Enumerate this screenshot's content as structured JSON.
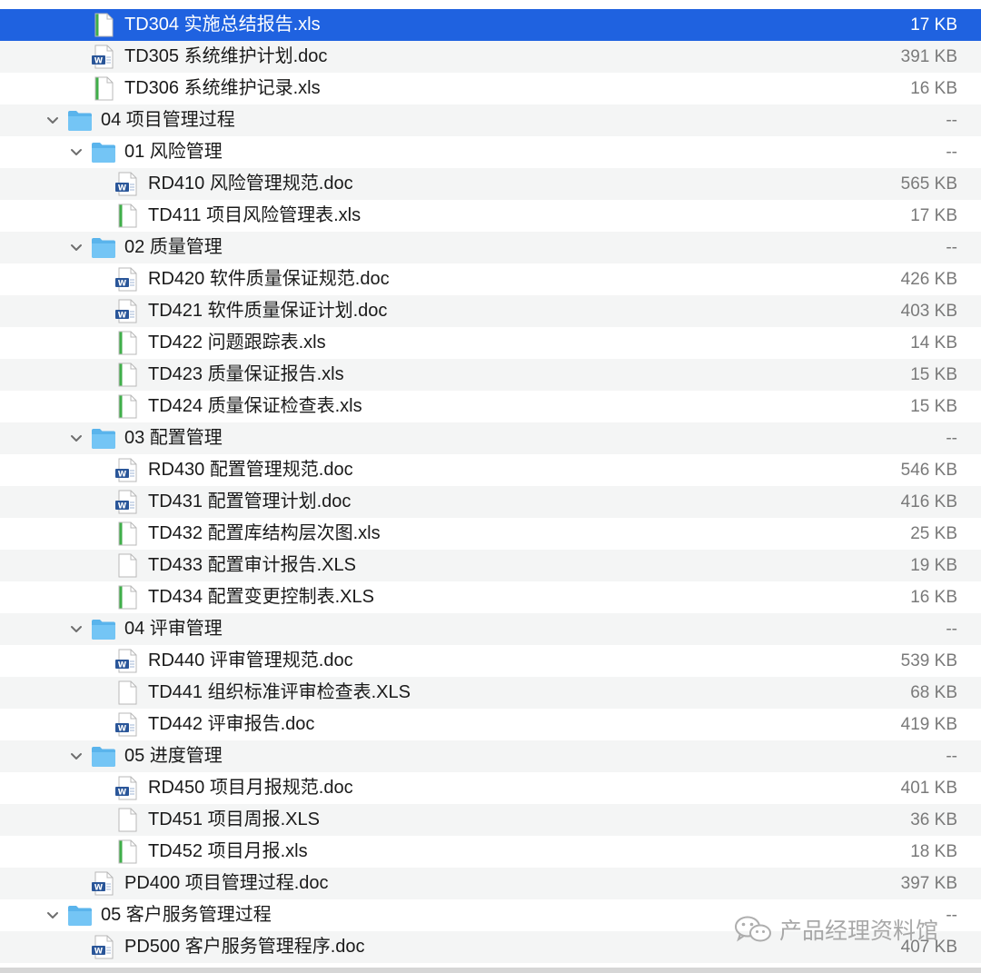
{
  "rows": [
    {
      "type": "xls",
      "name": "TD304 实施总结报告.xls",
      "size": "17 KB",
      "selected": true
    },
    {
      "type": "doc",
      "name": "TD305 系统维护计划.doc",
      "size": "391 KB"
    },
    {
      "type": "xls",
      "name": "TD306 系统维护记录.xls",
      "size": "16 KB"
    },
    {
      "type": "folder",
      "name": "04 项目管理过程",
      "size": "--",
      "expanded": true
    },
    {
      "type": "folder",
      "name": "01 风险管理",
      "size": "--",
      "expanded": true
    },
    {
      "type": "doc",
      "name": "RD410 风险管理规范.doc",
      "size": "565 KB"
    },
    {
      "type": "xls",
      "name": "TD411 项目风险管理表.xls",
      "size": "17 KB"
    },
    {
      "type": "folder",
      "name": "02 质量管理",
      "size": "--",
      "expanded": true
    },
    {
      "type": "doc",
      "name": "RD420 软件质量保证规范.doc",
      "size": "426 KB"
    },
    {
      "type": "doc",
      "name": "TD421 软件质量保证计划.doc",
      "size": "403 KB"
    },
    {
      "type": "xls",
      "name": "TD422 问题跟踪表.xls",
      "size": "14 KB"
    },
    {
      "type": "xls",
      "name": "TD423 质量保证报告.xls",
      "size": "15 KB"
    },
    {
      "type": "xls",
      "name": "TD424 质量保证检查表.xls",
      "size": "15 KB"
    },
    {
      "type": "folder",
      "name": "03 配置管理",
      "size": "--",
      "expanded": true
    },
    {
      "type": "doc",
      "name": "RD430 配置管理规范.doc",
      "size": "546 KB"
    },
    {
      "type": "doc",
      "name": "TD431 配置管理计划.doc",
      "size": "416 KB"
    },
    {
      "type": "xls",
      "name": "TD432 配置库结构层次图.xls",
      "size": "25 KB"
    },
    {
      "type": "xls-plain",
      "name": "TD433 配置审计报告.XLS",
      "size": "19 KB"
    },
    {
      "type": "xls",
      "name": "TD434 配置变更控制表.XLS",
      "size": "16 KB"
    },
    {
      "type": "folder",
      "name": "04 评审管理",
      "size": "--",
      "expanded": true
    },
    {
      "type": "doc",
      "name": "RD440 评审管理规范.doc",
      "size": "539 KB"
    },
    {
      "type": "xls-plain",
      "name": "TD441 组织标准评审检查表.XLS",
      "size": "68 KB"
    },
    {
      "type": "doc",
      "name": "TD442 评审报告.doc",
      "size": "419 KB"
    },
    {
      "type": "folder",
      "name": "05 进度管理",
      "size": "--",
      "expanded": true
    },
    {
      "type": "doc",
      "name": "RD450 项目月报规范.doc",
      "size": "401 KB"
    },
    {
      "type": "xls-plain",
      "name": "TD451 项目周报.XLS",
      "size": "36 KB"
    },
    {
      "type": "xls",
      "name": "TD452 项目月报.xls",
      "size": "18 KB"
    },
    {
      "type": "doc",
      "name": "PD400 项目管理过程.doc",
      "size": "397 KB"
    },
    {
      "type": "folder",
      "name": "05 客户服务管理过程",
      "size": "--",
      "expanded": true
    },
    {
      "type": "doc",
      "name": "PD500 客户服务管理程序.doc",
      "size": "407 KB"
    }
  ],
  "watermark": {
    "text": "产品经理资料馆",
    "icon": "wechat-icon"
  },
  "colors": {
    "selection": "#1f62e0",
    "folder": "#5ab4ec",
    "stripe": "#f4f5f5",
    "size_text": "#7a7a7a"
  }
}
